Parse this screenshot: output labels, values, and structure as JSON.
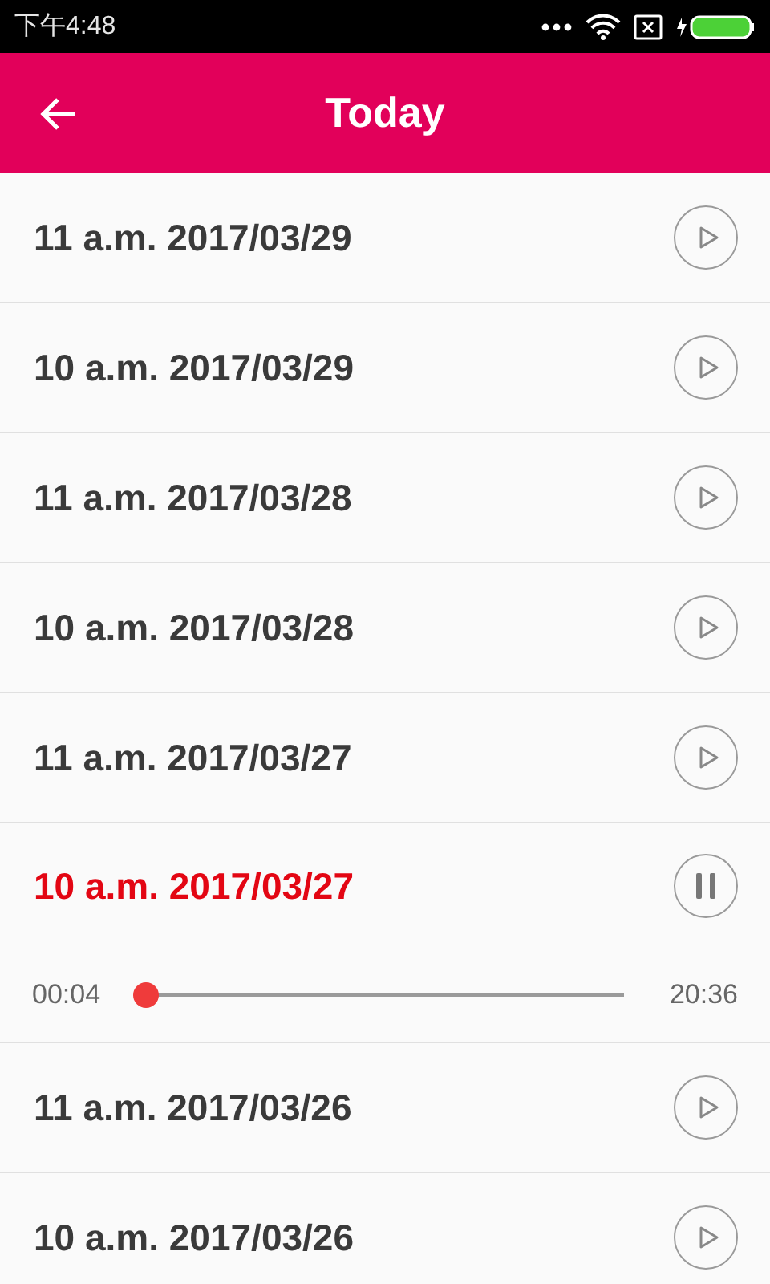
{
  "status_bar": {
    "time": "下午4:48"
  },
  "header": {
    "title": "Today"
  },
  "recordings": [
    {
      "title": "11 a.m. 2017/03/29",
      "playing": false
    },
    {
      "title": "10 a.m. 2017/03/29",
      "playing": false
    },
    {
      "title": "11 a.m. 2017/03/28",
      "playing": false
    },
    {
      "title": "10 a.m. 2017/03/28",
      "playing": false
    },
    {
      "title": "11 a.m. 2017/03/27",
      "playing": false
    },
    {
      "title": "10 a.m. 2017/03/27",
      "playing": true,
      "player": {
        "elapsed": "00:04",
        "total": "20:36",
        "level": 0.003
      }
    },
    {
      "title": "11 a.m. 2017/03/26",
      "playing": false
    },
    {
      "title": "10 a.m. 2017/03/26",
      "playing": false
    }
  ]
}
